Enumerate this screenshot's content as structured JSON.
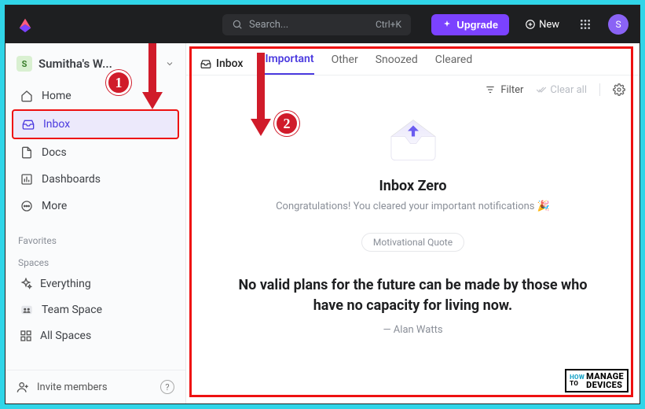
{
  "header": {
    "search_placeholder": "Search...",
    "shortcut": "Ctrl+K",
    "upgrade": "Upgrade",
    "new": "New",
    "avatar_initial": "S"
  },
  "workspace": {
    "badge": "S",
    "name": "Sumitha's W..."
  },
  "nav": {
    "home": "Home",
    "inbox": "Inbox",
    "docs": "Docs",
    "dashboards": "Dashboards",
    "more": "More"
  },
  "sections": {
    "favorites": "Favorites",
    "spaces": "Spaces"
  },
  "spaces": {
    "everything": "Everything",
    "team": "Team Space",
    "all": "All Spaces"
  },
  "invite": "Invite members",
  "main": {
    "crumb": "Inbox",
    "tabs": {
      "important": "Important",
      "other": "Other",
      "snoozed": "Snoozed",
      "cleared": "Cleared"
    },
    "filter": "Filter",
    "clear_all": "Clear all",
    "empty_title": "Inbox Zero",
    "empty_sub": "Congratulations! You cleared your important notifications 🎉",
    "mq_chip": "Motivational Quote",
    "quote": "No valid plans for the future can be made by those who have no capacity for living now.",
    "author": "— Alan Watts"
  },
  "annotations": {
    "one": "1",
    "two": "2"
  },
  "watermark": {
    "how": "HOW",
    "to": "TO",
    "manage": "MANAGE",
    "devices": "DEVICES"
  }
}
